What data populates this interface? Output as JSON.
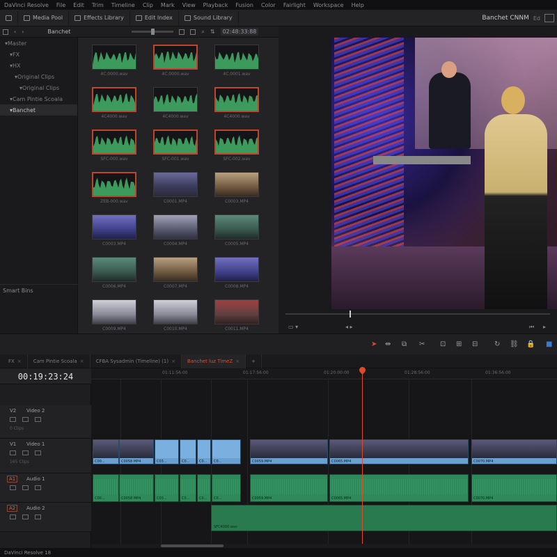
{
  "menu": [
    "DaVinci Resolve",
    "File",
    "Edit",
    "Trim",
    "Timeline",
    "Clip",
    "Mark",
    "View",
    "Playback",
    "Fusion",
    "Color",
    "Fairlight",
    "Workspace",
    "Help"
  ],
  "toolbar": {
    "media_pool": "Media Pool",
    "effects_library": "Effects Library",
    "edit_index": "Edit Index",
    "sound_library": "Sound Library",
    "project_name": "Banchet CNNM",
    "project_suffix": "Ed"
  },
  "subbar": {
    "bin_name": "Banchet",
    "timecode": "02:48:33:88"
  },
  "bins": [
    {
      "label": "Master",
      "indent": 1,
      "selected": false
    },
    {
      "label": "FX",
      "indent": 2,
      "selected": false
    },
    {
      "label": "HX",
      "indent": 2,
      "selected": false
    },
    {
      "label": "Original Clips",
      "indent": 3,
      "selected": false
    },
    {
      "label": "Original Clips",
      "indent": 4,
      "selected": false
    },
    {
      "label": "Cam Pintie Scoala",
      "indent": 2,
      "selected": false
    },
    {
      "label": "Banchet",
      "indent": 2,
      "selected": true
    }
  ],
  "smart_bins_label": "Smart Bins",
  "clips": [
    {
      "name": "4C.0000.wav",
      "kind": "audio",
      "selected": false
    },
    {
      "name": "4C.0000.wav",
      "kind": "audio",
      "selected": true
    },
    {
      "name": "4C.0001.wav",
      "kind": "audio",
      "selected": false
    },
    {
      "name": "4C4000.wav",
      "kind": "audio",
      "selected": true
    },
    {
      "name": "4C4000.wav",
      "kind": "audio",
      "selected": false
    },
    {
      "name": "4C4000.wav",
      "kind": "audio",
      "selected": true
    },
    {
      "name": "SFC-000.wav",
      "kind": "audio",
      "selected": true
    },
    {
      "name": "SFC-001.wav",
      "kind": "audio",
      "selected": true
    },
    {
      "name": "SFC-002.wav",
      "kind": "audio",
      "selected": true
    },
    {
      "name": "ZEB-000.wav",
      "kind": "audio",
      "selected": true
    },
    {
      "name": "C0001.MP4",
      "kind": "video",
      "variant": "v1",
      "selected": false
    },
    {
      "name": "C0003.MP4",
      "kind": "video",
      "variant": "v5",
      "selected": false
    },
    {
      "name": "C0003.MP4",
      "kind": "video",
      "variant": "v3",
      "selected": false
    },
    {
      "name": "C0004.MP4",
      "kind": "video",
      "variant": "v2",
      "selected": false
    },
    {
      "name": "C0005.MP4",
      "kind": "video",
      "variant": "v4",
      "selected": false
    },
    {
      "name": "C0006.MP4",
      "kind": "video",
      "variant": "v4",
      "selected": false
    },
    {
      "name": "C0007.MP4",
      "kind": "video",
      "variant": "v5",
      "selected": false
    },
    {
      "name": "C0008.MP4",
      "kind": "video",
      "variant": "v3",
      "selected": false
    },
    {
      "name": "C0009.MP4",
      "kind": "video",
      "variant": "v6",
      "selected": false
    },
    {
      "name": "C0010.MP4",
      "kind": "video",
      "variant": "v6",
      "selected": false
    },
    {
      "name": "C0011.MP4",
      "kind": "video",
      "variant": "v7",
      "selected": false
    }
  ],
  "tabs": [
    {
      "label": "FX",
      "active": false
    },
    {
      "label": "Cam Pintie Scoala",
      "active": false
    },
    {
      "label": "CFBA Sysadmin (Timeline) (1)",
      "active": false
    },
    {
      "label": "Banchet luz TimeZ",
      "active": true
    }
  ],
  "timeline": {
    "timecode": "00:19:23:24",
    "ruler": [
      "01:11:56:00",
      "01:17:56:00",
      "01:20:00:00",
      "01:28:56:00",
      "01:36:56:00"
    ],
    "tracks": [
      {
        "id": "V2",
        "name": "Video 2",
        "count": "0 Clips",
        "type": "video"
      },
      {
        "id": "V1",
        "name": "Video 1",
        "count": "165 Clips",
        "type": "video"
      },
      {
        "id": "A1",
        "name": "Audio 1",
        "count": "",
        "type": "audio"
      },
      {
        "id": "A2",
        "name": "Audio 2",
        "count": "",
        "type": "audio"
      }
    ],
    "video_clip_labels": [
      "C00...",
      "C0058 MP4",
      "C03...",
      "C0...",
      "C0...",
      "C0...",
      "C0059.MP4",
      "C0065.MP4",
      "C0070.MP4"
    ],
    "audio_clip_labels": [
      "C00...",
      "C0058 MP4",
      "C03...",
      "C0...",
      "C0...",
      "C0...",
      "C0059.MP4",
      "C0065.MP4",
      "C0070.MP4"
    ],
    "audio2_label": "SFC4000.wav"
  },
  "status_bar": "DaVinci Resolve 18"
}
